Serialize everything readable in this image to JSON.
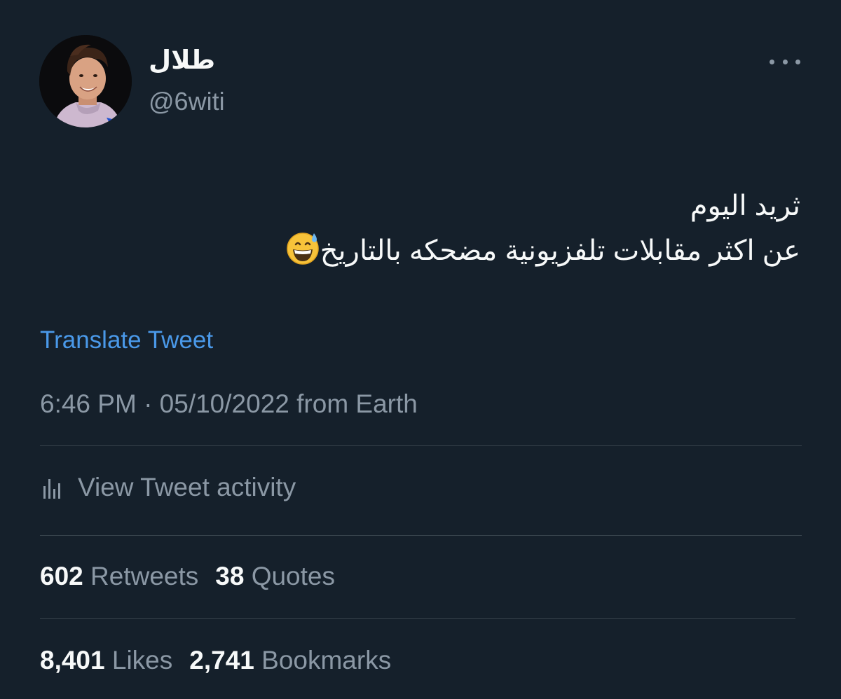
{
  "user": {
    "display_name": "طلال",
    "handle": "@6witi"
  },
  "tweet": {
    "line1": "ثريد اليوم",
    "line2": "عن اكثر مقابلات تلفزيونية مضحكه بالتاريخ",
    "emoji": "grinning-face-with-sweat-icon"
  },
  "translate_label": "Translate Tweet",
  "timestamp": "6:46 PM · 05/10/2022 from Earth",
  "activity_label": "View Tweet activity",
  "stats": {
    "retweets": {
      "count": "602",
      "label": "Retweets"
    },
    "quotes": {
      "count": "38",
      "label": "Quotes"
    },
    "likes": {
      "count": "8,401",
      "label": "Likes"
    },
    "bookmarks": {
      "count": "2,741",
      "label": "Bookmarks"
    }
  },
  "colors": {
    "background": "#15202b",
    "link": "#4a99e9",
    "secondary_text": "#8b98a5",
    "divider": "#38444d"
  }
}
